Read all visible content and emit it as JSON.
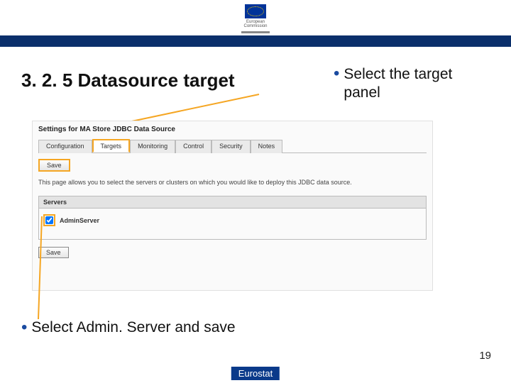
{
  "logo": {
    "label": "European\nCommission"
  },
  "title": "3. 2. 5 Datasource target",
  "bullet_right": "Select the target panel",
  "bullet_bottom": "Select Admin. Server and save",
  "panel": {
    "settings_title": "Settings for MA Store JDBC Data Source",
    "tabs": [
      "Configuration",
      "Targets",
      "Monitoring",
      "Control",
      "Security",
      "Notes"
    ],
    "active_tab_index": 1,
    "save_label": "Save",
    "description": "This page allows you to select the servers or clusters on which you would like to deploy this JDBC data source.",
    "servers_header": "Servers",
    "server_name": "AdminServer",
    "server_checked": true
  },
  "page_number": "19",
  "footer": "Eurostat",
  "colors": {
    "highlight": "#f5a623",
    "banner": "#0a2f6b",
    "footer": "#0a3a8a"
  }
}
